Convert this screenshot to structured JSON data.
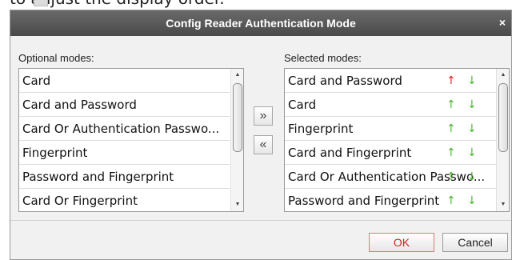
{
  "background": {
    "caption_fragment": "to adjust the display order."
  },
  "dialog": {
    "title": "Config Reader Authentication Mode",
    "close_icon": "close-icon",
    "optional_label": "Optional modes:",
    "selected_label": "Selected modes:",
    "optional_items": [
      "Card",
      "Card and Password",
      "Card Or Authentication Passwo...",
      "Fingerprint",
      "Password and Fingerprint",
      "Card Or Fingerprint"
    ],
    "selected_items": [
      "Card and Password",
      "Card",
      "Fingerprint",
      "Card and Fingerprint",
      "Card Or Authentication Passwo...",
      "Password and Fingerprint"
    ],
    "move_right_glyph": "»",
    "move_left_glyph": "«",
    "ok_label": "OK",
    "cancel_label": "Cancel",
    "colors": {
      "titlebar": "#555555",
      "up_arrow_active": "#e02020",
      "arrow_green": "#4cb830",
      "ok_text": "#d02020"
    }
  }
}
